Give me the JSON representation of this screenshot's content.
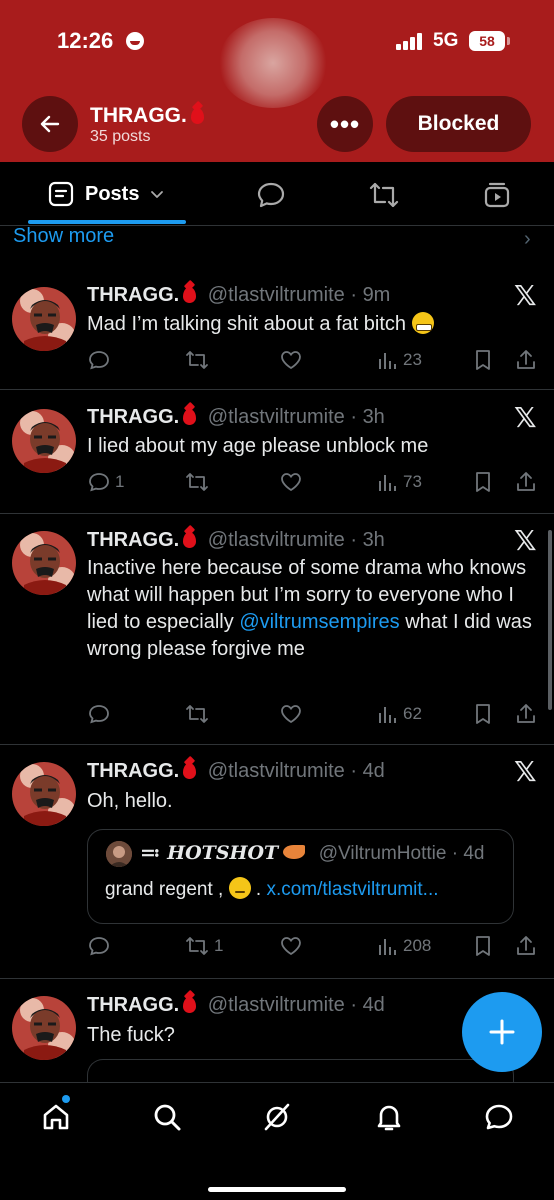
{
  "status_bar": {
    "time": "12:26",
    "network": "5G",
    "battery": "58"
  },
  "header": {
    "title": "THRAGG.",
    "post_count": "35 posts",
    "blocked_label": "Blocked"
  },
  "tabs": {
    "active_label": "Posts"
  },
  "show_more": "Show more",
  "posts": [
    {
      "name": "THRAGG.",
      "handle": "@tlastviltrumite",
      "time": "9m",
      "text": "Mad I’m talking shit about a fat bitch",
      "replies": "",
      "reposts": "",
      "views": "23"
    },
    {
      "name": "THRAGG.",
      "handle": "@tlastviltrumite",
      "time": "3h",
      "text": "I lied about my age please unblock me",
      "replies": "1",
      "reposts": "",
      "views": "73"
    },
    {
      "name": "THRAGG.",
      "handle": "@tlastviltrumite",
      "time": "3h",
      "text_before": "Inactive here because of some drama who knows what will happen but I’m sorry to everyone who I lied to especially ",
      "mention": "@viltrumsempires",
      "text_after": " what I did was wrong please forgive me",
      "replies": "",
      "reposts": "",
      "views": "62"
    },
    {
      "name": "THRAGG.",
      "handle": "@tlastviltrumite",
      "time": "4d",
      "text": "Oh, hello.",
      "replies": "",
      "reposts": "1",
      "views": "208",
      "quote": {
        "name": "≕ HOTSHOT",
        "handle": "@ViltrumHottie",
        "time": "4d",
        "text": "grand regent ,",
        "link": "x.com/tlastviltrumit..."
      }
    },
    {
      "name": "THRAGG.",
      "handle": "@tlastviltrumite",
      "time": "4d",
      "text": "The fuck?"
    }
  ],
  "colors": {
    "banner": "#a81c1c",
    "accent": "#1d9bf0",
    "button_dark": "#5e1010"
  },
  "icons": [
    "back-arrow-icon",
    "more-dots-icon",
    "posts-tab-icon",
    "chevron-down-icon",
    "replies-tab-icon",
    "reposts-tab-icon",
    "media-tab-icon",
    "x-logo-icon",
    "reply-icon",
    "repost-icon",
    "like-icon",
    "views-icon",
    "bookmark-icon",
    "share-icon",
    "compose-plus-icon",
    "home-icon",
    "search-icon",
    "grok-icon",
    "notifications-icon",
    "messages-icon"
  ]
}
